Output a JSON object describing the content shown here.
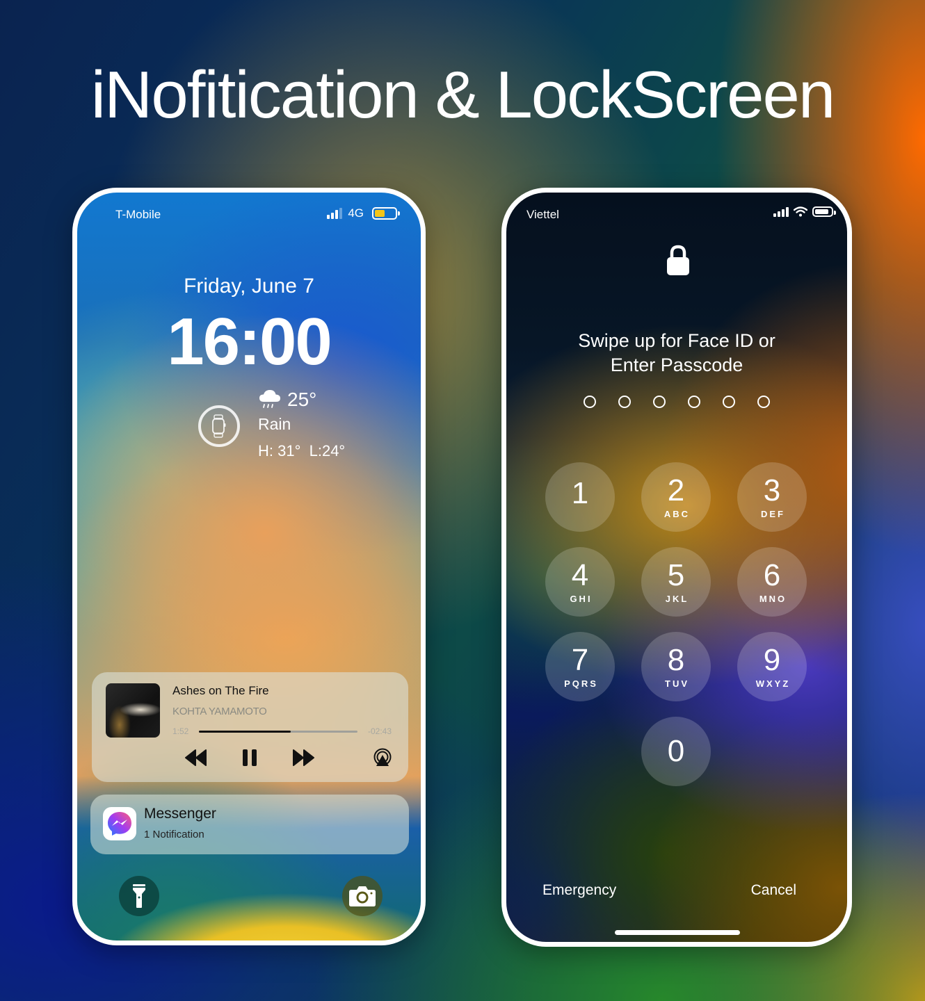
{
  "headline": "iNofitication & LockScreen",
  "left_phone": {
    "status_bar": {
      "carrier": "T-Mobile",
      "network": "4G",
      "signal_bars_active": 3,
      "signal_bars_total": 4,
      "battery_level": 0.5,
      "battery_color": "#f5c518"
    },
    "date": "Friday, June 7",
    "time": "16:00",
    "watch_widget": {
      "icon": "watch-icon"
    },
    "weather": {
      "icon": "cloud-rain-icon",
      "temperature": "25°",
      "condition": "Rain",
      "high_low": "H: 31°  L:24°"
    },
    "now_playing": {
      "title": "Ashes on The Fire",
      "artist": "KOHTA YAMAMOTO",
      "elapsed": "1:52",
      "remaining": "-02:43",
      "progress": 0.58,
      "controls": [
        "rewind-icon",
        "pause-icon",
        "fast-forward-icon",
        "airplay-icon"
      ]
    },
    "notification": {
      "app": "Messenger",
      "summary": "1 Notification",
      "icon": "messenger-icon"
    },
    "quick_actions": [
      "flashlight-icon",
      "camera-icon"
    ]
  },
  "right_phone": {
    "status_bar": {
      "carrier": "Viettel",
      "signal_bars_active": 4,
      "signal_bars_total": 4,
      "wifi": true,
      "battery_level": 0.85
    },
    "lock_icon": "lock-icon",
    "prompt_line1": "Swipe up for Face ID or",
    "prompt_line2": "Enter Passcode",
    "passcode_length": 6,
    "passcode_entered": 0,
    "keys": [
      {
        "num": "1",
        "letters": ""
      },
      {
        "num": "2",
        "letters": "ABC"
      },
      {
        "num": "3",
        "letters": "DEF"
      },
      {
        "num": "4",
        "letters": "GHI"
      },
      {
        "num": "5",
        "letters": "JKL"
      },
      {
        "num": "6",
        "letters": "MNO"
      },
      {
        "num": "7",
        "letters": "PQRS"
      },
      {
        "num": "8",
        "letters": "TUV"
      },
      {
        "num": "9",
        "letters": "WXYZ"
      },
      {
        "num": "0",
        "letters": ""
      }
    ],
    "emergency_label": "Emergency",
    "cancel_label": "Cancel"
  }
}
